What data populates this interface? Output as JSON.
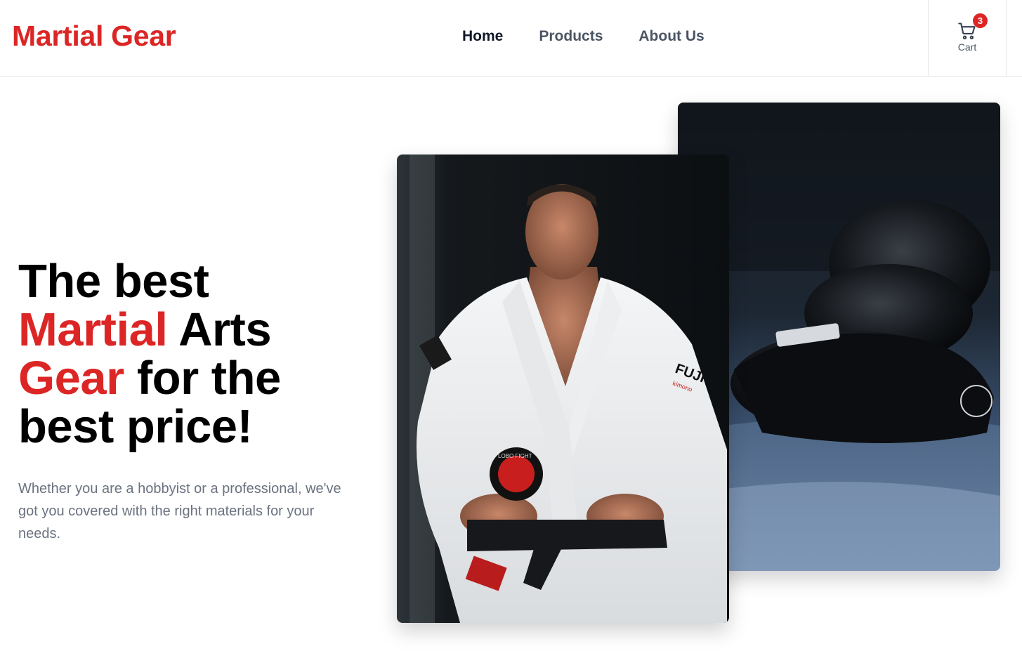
{
  "header": {
    "brand": "Martial Gear",
    "nav": [
      {
        "label": "Home",
        "active": true
      },
      {
        "label": "Products",
        "active": false
      },
      {
        "label": "About Us",
        "active": false
      }
    ],
    "cart": {
      "label": "Cart",
      "count": "3",
      "icon": "cart-icon"
    }
  },
  "hero": {
    "title": {
      "line1": "The best",
      "accent1": "Martial",
      "line2_rest": " Arts",
      "accent2": "Gear",
      "line3_rest": " for the",
      "line4": "best price!"
    },
    "description": "Whether you are a hobbyist or a professional, we've got you covered with the right materials for your needs."
  },
  "images": {
    "fighter_patch": "FUJI",
    "fighter_patch_sub": "kimono",
    "belt_patch": "LOBO FIGHT"
  },
  "colors": {
    "accent": "#dc2626",
    "text_dark": "#111827",
    "text_muted": "#6b7280"
  }
}
